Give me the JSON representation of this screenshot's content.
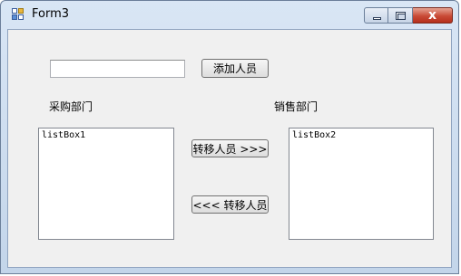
{
  "window": {
    "title": "Form3",
    "caption_buttons": [
      "minimize-icon",
      "maximize-icon",
      "close-icon"
    ],
    "close_glyph": "x"
  },
  "form": {
    "name_input_value": "",
    "add_button_label": "添加人员",
    "left_label": "采购部门",
    "right_label": "销售部门",
    "left_listbox_text": "listBox1",
    "right_listbox_text": "listBox2",
    "move_right_label": "转移人员 >>>",
    "move_left_label": "<<< 转移人员"
  },
  "colors": {
    "close_button": "#c94a36",
    "client_background": "#f0f0f0",
    "titlebar": "#c3d5ea"
  }
}
